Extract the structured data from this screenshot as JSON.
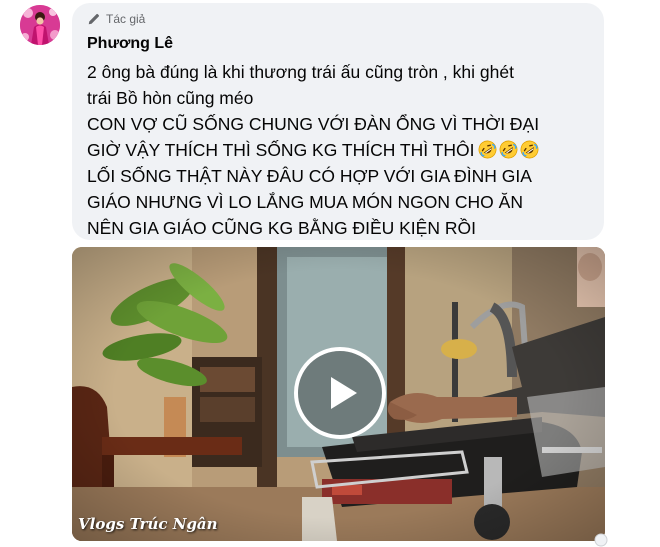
{
  "comment": {
    "author_badge": "Tác giả",
    "author_name": "Phương Lê",
    "lines": [
      "2 ông bà đúng là khi thương trái ấu cũng tròn , khi ghét",
      "trái Bồ hòn cũng méo",
      "CON VỢ CŨ SỐNG CHUNG VỚI ĐÀN ỔNG VÌ THỜI ĐẠI",
      "GIỜ VẬY THÍCH THÌ SỐNG KG THÍCH THÌ THÔI",
      "LỐI SỐNG THẬT NÀY ĐÂU CÓ HỢP VỚI GIA ĐÌNH GIA",
      "GIÁO NHƯNG VÌ LO LẮNG MUA MÓN NGON CHO ĂN",
      "NÊN GIA GIÁO CŨNG KG BẰNG ĐIỀU KIỆN RỒI"
    ],
    "emoji_count": 3,
    "emoji_name": "rolling-on-floor-laughing-emoji"
  },
  "video": {
    "watermark": "Vlogs Trúc Ngân",
    "play_icon": "play-icon"
  },
  "colors": {
    "bubble_bg": "#f0f2f5",
    "badge_text": "#65676b",
    "text": "#050505"
  }
}
